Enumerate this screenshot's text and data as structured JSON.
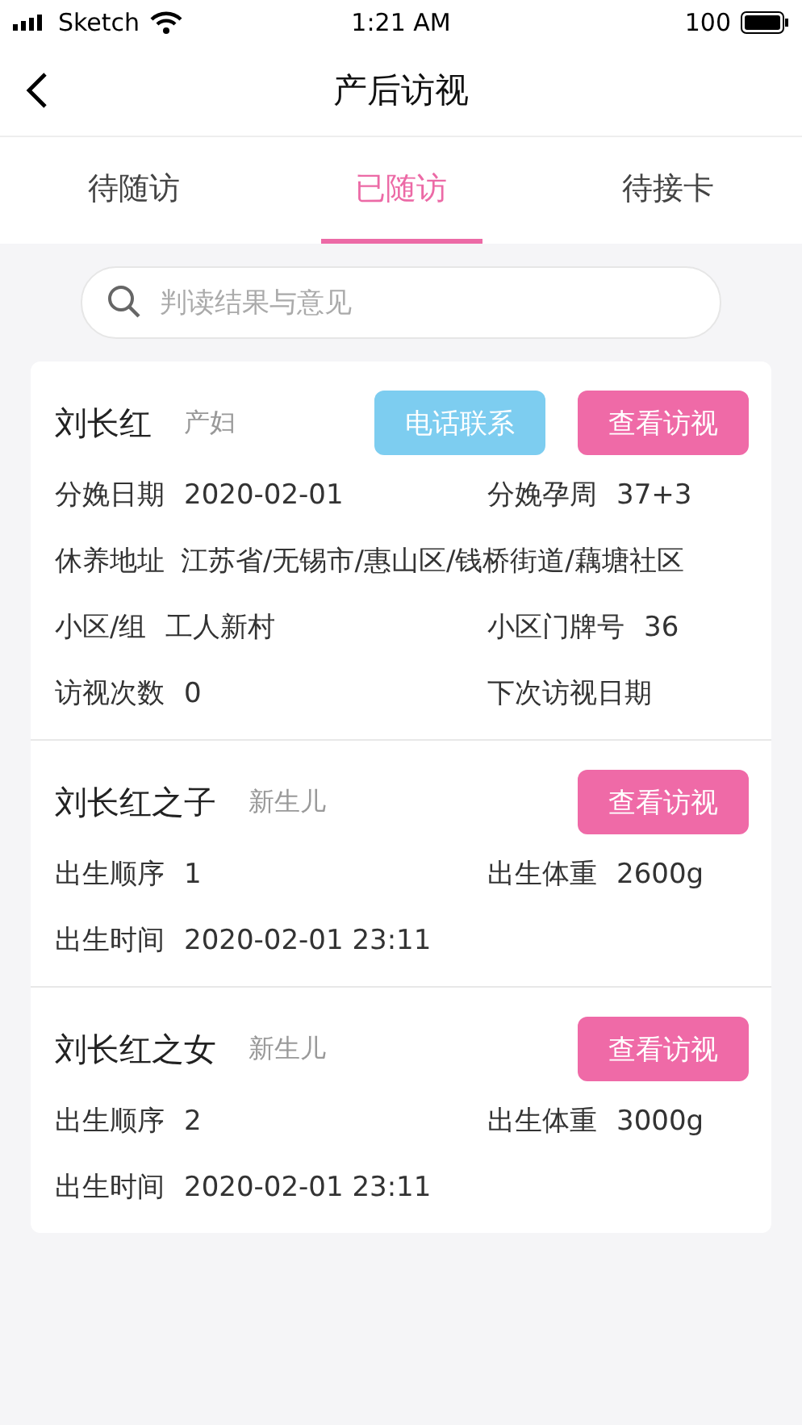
{
  "status_bar": {
    "carrier": "Sketch",
    "time": "1:21 AM",
    "battery": "100"
  },
  "nav": {
    "title": "产后访视"
  },
  "tabs": [
    {
      "label": "待随访",
      "selected": false
    },
    {
      "label": "已随访",
      "selected": true
    },
    {
      "label": "待接卡",
      "selected": false
    }
  ],
  "search": {
    "placeholder": "判读结果与意见"
  },
  "records": [
    {
      "name": "刘长红",
      "role": "产妇",
      "buttons": [
        {
          "label": "电话联系",
          "kind": "phone"
        },
        {
          "label": "查看访视",
          "kind": "view"
        }
      ],
      "fields": [
        {
          "label": "分娩日期",
          "value": "2020-02-01"
        },
        {
          "label": "分娩孕周",
          "value": "37+3"
        },
        {
          "label": "休养地址",
          "value": "江苏省/无锡市/惠山区/钱桥街道/藕塘社区",
          "wide": true
        },
        {
          "label": "小区/组",
          "value": "工人新村"
        },
        {
          "label": "小区门牌号",
          "value": "36"
        },
        {
          "label": "访视次数",
          "value": "0"
        },
        {
          "label": "下次访视日期"
        }
      ]
    },
    {
      "name": "刘长红之子",
      "role": "新生儿",
      "buttons": [
        {
          "label": "查看访视",
          "kind": "view"
        }
      ],
      "fields": [
        {
          "label": "出生顺序",
          "value": "1"
        },
        {
          "label": "出生体重",
          "value": "2600g"
        },
        {
          "label": "出生时间",
          "value": "2020-02-01 23:11"
        }
      ]
    },
    {
      "name": "刘长红之女",
      "role": "新生儿",
      "buttons": [
        {
          "label": "查看访视",
          "kind": "view"
        }
      ],
      "fields": [
        {
          "label": "出生顺序",
          "value": "2"
        },
        {
          "label": "出生体重",
          "value": "3000g"
        },
        {
          "label": "出生时间",
          "value": "2020-02-01 23:11"
        }
      ]
    }
  ]
}
